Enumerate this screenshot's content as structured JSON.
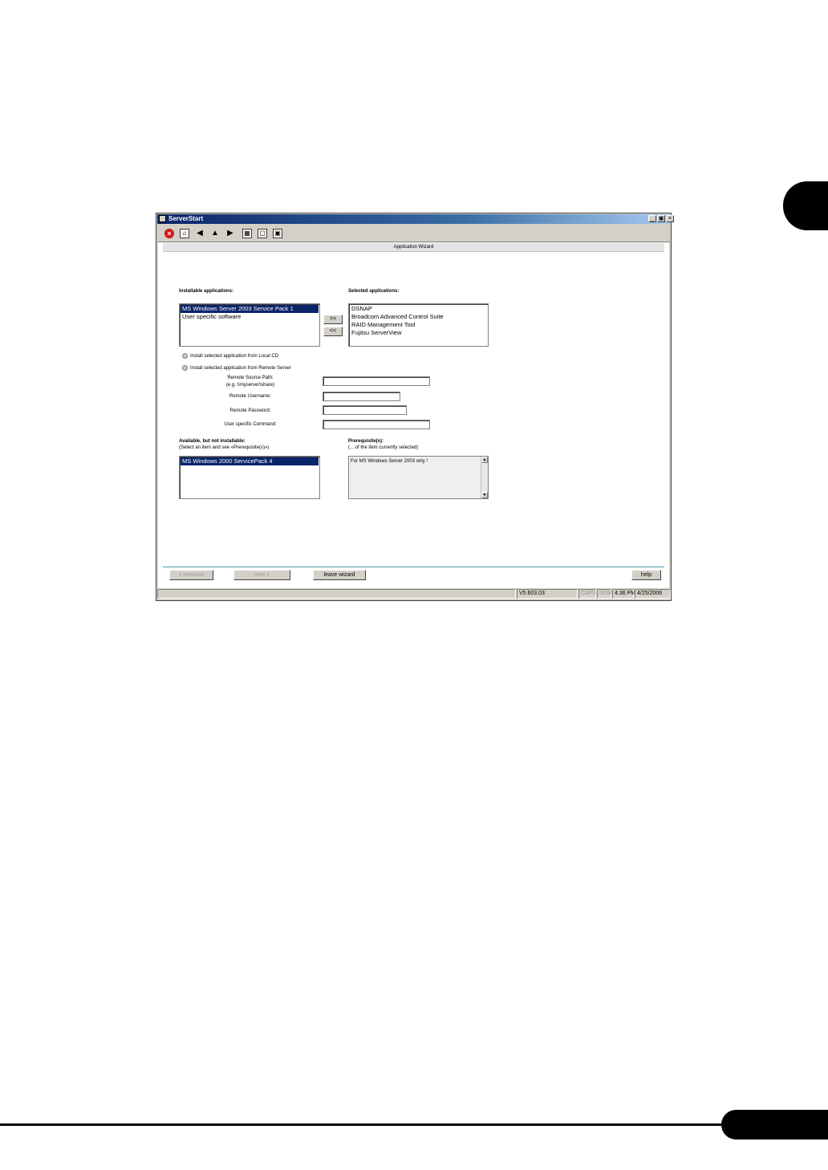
{
  "window": {
    "title": "ServerStart",
    "controls": {
      "minimize": "_",
      "restore": "▣",
      "close": "×"
    }
  },
  "toolbar": {
    "icons": [
      "stop-icon",
      "home-icon",
      "back-icon",
      "warning-icon",
      "forward-icon",
      "grid-icon",
      "window-icon",
      "image-icon"
    ]
  },
  "wizard": {
    "header": "Application Wizard",
    "installable": {
      "label": "Installable applications:",
      "items": [
        "MS Windows Server 2003 Service Pack 1",
        "User specific software"
      ],
      "selected_index": 0
    },
    "selected": {
      "label": "Selected applications:",
      "items": [
        "DSNAP",
        "Broadcom Advanced Control Suite",
        "RAID Management Tool",
        "Fujitsu ServerView"
      ]
    },
    "move_buttons": {
      "add": ">>",
      "remove": "<<"
    },
    "source_options": {
      "local": "Install selected application from Local CD",
      "remote": "Install selected application from Remote Server"
    },
    "remote_fields": {
      "source_path_label": "Remote Source Path:",
      "source_path_hint": "(e.g. \\\\myserver\\share)",
      "username_label": "Remote Username:",
      "password_label": "Remote Password:",
      "command_label": "User specific Command:"
    },
    "not_installable": {
      "label": "Available, but not installable:",
      "hint": "(Select an item and see «Prerequisite(s)»)",
      "items": [
        "MS Windows 2000 ServicePack 4"
      ],
      "selected_index": 0
    },
    "prerequisites": {
      "label": "Prerequisite(s):",
      "hint": "(... of the item currently selected)",
      "text": "For MS Windows Server 2003 only !"
    },
    "buttons": {
      "previous": "< previous",
      "next": "next >",
      "leave": "leave wizard",
      "help": "help"
    }
  },
  "statusbar": {
    "version": "V5.603.03",
    "caps": "CAPS",
    "num": "NUM",
    "time": "4:36 PM",
    "date": "4/25/2006"
  }
}
